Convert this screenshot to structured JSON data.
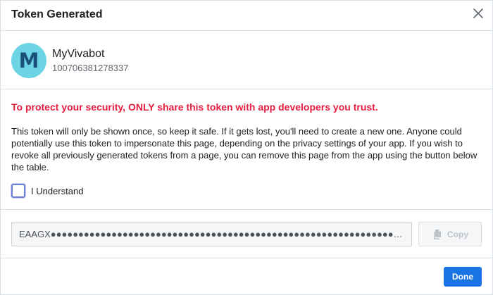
{
  "dialog": {
    "title": "Token Generated",
    "close_icon": "close-icon"
  },
  "account": {
    "avatar_letter": "M",
    "avatar_color": "#6dd4e6",
    "name": "MyVivabot",
    "id": "100706381278337"
  },
  "warning": "To protect your security, ONLY share this token with app developers you trust.",
  "body_text": "This token will only be shown once, so keep it safe. If it gets lost, you'll need to create a new one. Anyone could potentially use this token to impersonate this page, depending on the privacy settings of your app. If you wish to revoke all previously generated tokens from a page, you can remove this page from the app using the button below the table.",
  "checkbox": {
    "label": "I Understand",
    "checked": false
  },
  "token": {
    "value": "EAAGX●●●●●●●●●●●●●●●●●●●●●●●●●●●●●●●●●●●●●●●●●●●●●●●●●●●●●●●●●●●●●●●●●●●●●●●●●●●●●●●●"
  },
  "copy_button": {
    "label": "Copy",
    "icon": "copy-icon"
  },
  "done_button": {
    "label": "Done"
  },
  "colors": {
    "warning": "#e41e3f",
    "primary": "#1b74e4"
  }
}
